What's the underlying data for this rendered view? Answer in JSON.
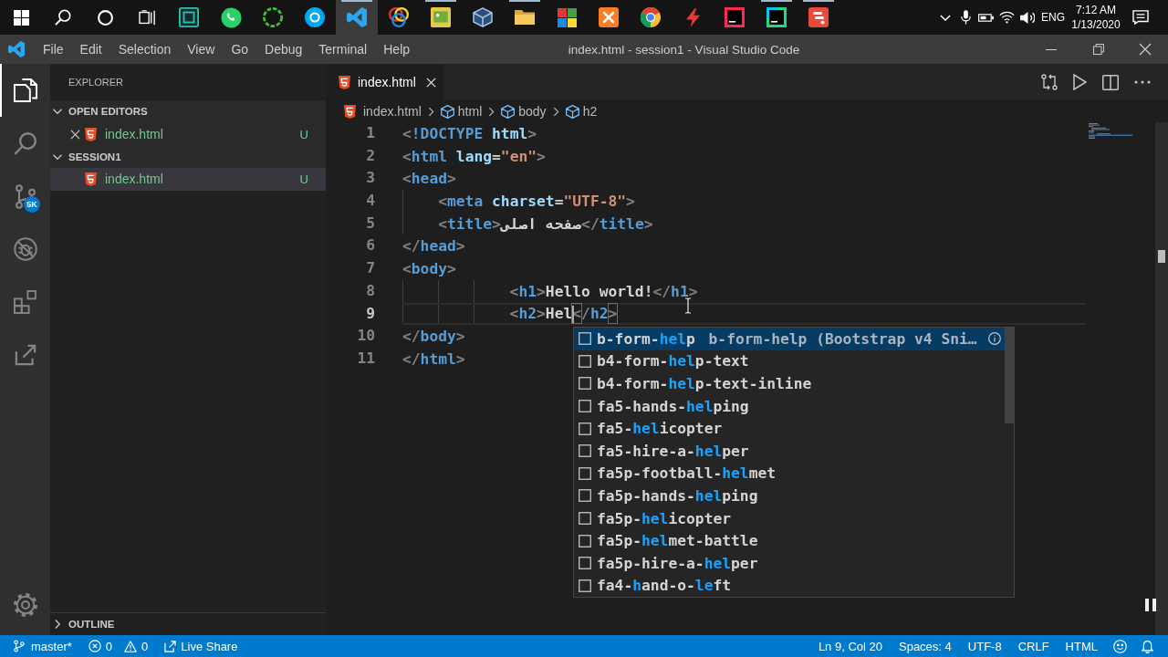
{
  "taskbar": {
    "buttons": [
      {
        "selected": false,
        "running": false
      },
      {
        "selected": false,
        "running": false
      },
      {
        "selected": false,
        "running": false
      },
      {
        "selected": false,
        "running": false
      },
      {
        "selected": false,
        "running": false
      },
      {
        "selected": false,
        "running": false
      },
      {
        "selected": false,
        "running": false
      },
      {
        "selected": false,
        "running": false
      },
      {
        "selected": true,
        "running": true
      },
      {
        "selected": false,
        "running": false
      },
      {
        "selected": false,
        "running": true
      },
      {
        "selected": false,
        "running": false
      },
      {
        "selected": false,
        "running": true
      },
      {
        "selected": false,
        "running": false
      },
      {
        "selected": false,
        "running": false
      },
      {
        "selected": false,
        "running": false
      },
      {
        "selected": false,
        "running": false
      },
      {
        "selected": false,
        "running": false
      },
      {
        "selected": false,
        "running": true
      },
      {
        "selected": false,
        "running": true
      }
    ],
    "tray": {
      "language": "ENG",
      "time": "7:12 AM",
      "date": "1/13/2020"
    }
  },
  "window": {
    "menu": [
      "File",
      "Edit",
      "Selection",
      "View",
      "Go",
      "Debug",
      "Terminal",
      "Help"
    ],
    "title": "index.html - session1 - Visual Studio Code"
  },
  "activity_bar": {
    "items": [
      {
        "selected": true
      },
      {
        "selected": false
      },
      {
        "selected": false,
        "badge": "5K"
      },
      {
        "selected": false
      },
      {
        "selected": false
      },
      {
        "selected": false
      }
    ]
  },
  "sidebar": {
    "title": "EXPLORER",
    "sections": [
      {
        "kind": "open_editors",
        "title": "OPEN EDITORS",
        "expanded": true,
        "items": [
          {
            "name": "index.html",
            "status": "U",
            "selected": false
          }
        ]
      },
      {
        "kind": "folder",
        "title": "SESSION1",
        "expanded": true,
        "items": [
          {
            "name": "index.html",
            "status": "U",
            "selected": true
          }
        ]
      }
    ],
    "outline": {
      "title": "OUTLINE",
      "expanded": false
    }
  },
  "tabs": [
    {
      "label": "index.html",
      "selected": true
    }
  ],
  "breadcrumb": [
    {
      "kind": "file",
      "label": "index.html"
    },
    {
      "kind": "element",
      "label": "html"
    },
    {
      "kind": "element",
      "label": "body"
    },
    {
      "kind": "element",
      "label": "h2"
    }
  ],
  "editor": {
    "lines": [
      {
        "number": "1",
        "current": false,
        "tokens": [
          {
            "kind": "punct",
            "text": "<"
          },
          {
            "kind": "tag",
            "text": "!DOCTYPE"
          },
          {
            "kind": "attr",
            "text": " html"
          },
          {
            "kind": "punct",
            "text": ">"
          }
        ]
      },
      {
        "number": "2",
        "current": false,
        "tokens": [
          {
            "kind": "punct",
            "text": "<"
          },
          {
            "kind": "tag",
            "text": "html"
          },
          {
            "kind": "attr",
            "text": " lang"
          },
          {
            "kind": "text",
            "text": "="
          },
          {
            "kind": "string",
            "text": "\"en\""
          },
          {
            "kind": "punct",
            "text": ">"
          }
        ]
      },
      {
        "number": "3",
        "current": false,
        "tokens": [
          {
            "kind": "punct",
            "text": "<"
          },
          {
            "kind": "tag",
            "text": "head"
          },
          {
            "kind": "punct",
            "text": ">"
          }
        ]
      },
      {
        "number": "4",
        "current": false,
        "tokens": [
          {
            "kind": "punct",
            "text": "    <"
          },
          {
            "kind": "tag",
            "text": "meta"
          },
          {
            "kind": "attr",
            "text": " charset"
          },
          {
            "kind": "text",
            "text": "="
          },
          {
            "kind": "string",
            "text": "\"UTF-8\""
          },
          {
            "kind": "punct",
            "text": ">"
          }
        ]
      },
      {
        "number": "5",
        "current": false,
        "tokens": [
          {
            "kind": "punct",
            "text": "    <"
          },
          {
            "kind": "tag",
            "text": "title"
          },
          {
            "kind": "punct",
            "text": ">"
          },
          {
            "kind": "text",
            "text": "صفحه اصلی"
          },
          {
            "kind": "punct",
            "text": "</"
          },
          {
            "kind": "tag",
            "text": "title"
          },
          {
            "kind": "punct",
            "text": ">"
          }
        ]
      },
      {
        "number": "6",
        "current": false,
        "tokens": [
          {
            "kind": "punct",
            "text": "</"
          },
          {
            "kind": "tag",
            "text": "head"
          },
          {
            "kind": "punct",
            "text": ">"
          }
        ]
      },
      {
        "number": "7",
        "current": false,
        "tokens": [
          {
            "kind": "punct",
            "text": "<"
          },
          {
            "kind": "tag",
            "text": "body"
          },
          {
            "kind": "punct",
            "text": ">"
          }
        ]
      },
      {
        "number": "8",
        "current": false,
        "tokens": [
          {
            "kind": "punct",
            "text": "            <"
          },
          {
            "kind": "tag",
            "text": "h1"
          },
          {
            "kind": "punct",
            "text": ">"
          },
          {
            "kind": "text",
            "text": "Hello world!"
          },
          {
            "kind": "punct",
            "text": "</"
          },
          {
            "kind": "tag",
            "text": "h1"
          },
          {
            "kind": "punct",
            "text": ">"
          }
        ]
      },
      {
        "number": "9",
        "current": true,
        "tokens": [
          {
            "kind": "punct",
            "text": "            <"
          },
          {
            "kind": "tag",
            "text": "h2"
          },
          {
            "kind": "punct",
            "text": ">"
          },
          {
            "kind": "text",
            "text": "Hel"
          },
          {
            "kind": "caret"
          },
          {
            "kind": "match",
            "text": "<"
          },
          {
            "kind": "punct",
            "text": "/"
          },
          {
            "kind": "tag",
            "text": "h2"
          },
          {
            "kind": "match",
            "text": ">"
          }
        ]
      },
      {
        "number": "10",
        "current": false,
        "tokens": [
          {
            "kind": "punct",
            "text": "</"
          },
          {
            "kind": "tag",
            "text": "body"
          },
          {
            "kind": "punct",
            "text": ">"
          }
        ]
      },
      {
        "number": "11",
        "current": false,
        "tokens": [
          {
            "kind": "punct",
            "text": "</"
          },
          {
            "kind": "tag",
            "text": "html"
          },
          {
            "kind": "punct",
            "text": ">"
          }
        ]
      }
    ]
  },
  "suggest": {
    "items": [
      {
        "parts": [
          {
            "text": "b-form-",
            "match": false
          },
          {
            "text": "hel",
            "match": true
          },
          {
            "text": "p",
            "match": false
          }
        ],
        "detail": "b-form-help (Bootstrap v4 Sni…",
        "selected": true
      },
      {
        "parts": [
          {
            "text": "b4-form-",
            "match": false
          },
          {
            "text": "hel",
            "match": true
          },
          {
            "text": "p-text",
            "match": false
          }
        ],
        "selected": false
      },
      {
        "parts": [
          {
            "text": "b4-form-",
            "match": false
          },
          {
            "text": "hel",
            "match": true
          },
          {
            "text": "p-text-inline",
            "match": false
          }
        ],
        "selected": false
      },
      {
        "parts": [
          {
            "text": "fa5-hands-",
            "match": false
          },
          {
            "text": "hel",
            "match": true
          },
          {
            "text": "ping",
            "match": false
          }
        ],
        "selected": false
      },
      {
        "parts": [
          {
            "text": "fa5-",
            "match": false
          },
          {
            "text": "hel",
            "match": true
          },
          {
            "text": "icopter",
            "match": false
          }
        ],
        "selected": false
      },
      {
        "parts": [
          {
            "text": "fa5-hire-a-",
            "match": false
          },
          {
            "text": "hel",
            "match": true
          },
          {
            "text": "per",
            "match": false
          }
        ],
        "selected": false
      },
      {
        "parts": [
          {
            "text": "fa5p-football-",
            "match": false
          },
          {
            "text": "hel",
            "match": true
          },
          {
            "text": "met",
            "match": false
          }
        ],
        "selected": false
      },
      {
        "parts": [
          {
            "text": "fa5p-hands-",
            "match": false
          },
          {
            "text": "hel",
            "match": true
          },
          {
            "text": "ping",
            "match": false
          }
        ],
        "selected": false
      },
      {
        "parts": [
          {
            "text": "fa5p-",
            "match": false
          },
          {
            "text": "hel",
            "match": true
          },
          {
            "text": "icopter",
            "match": false
          }
        ],
        "selected": false
      },
      {
        "parts": [
          {
            "text": "fa5p-",
            "match": false
          },
          {
            "text": "hel",
            "match": true
          },
          {
            "text": "met-battle",
            "match": false
          }
        ],
        "selected": false
      },
      {
        "parts": [
          {
            "text": "fa5p-hire-a-",
            "match": false
          },
          {
            "text": "hel",
            "match": true
          },
          {
            "text": "per",
            "match": false
          }
        ],
        "selected": false
      },
      {
        "parts": [
          {
            "text": "fa4-",
            "match": false
          },
          {
            "text": "h",
            "match": true
          },
          {
            "text": "and-o-",
            "match": false
          },
          {
            "text": "le",
            "match": true
          },
          {
            "text": "ft",
            "match": false
          }
        ],
        "selected": false
      }
    ]
  },
  "status_bar": {
    "branch": "master*",
    "errors": "0",
    "warnings": "0",
    "live_share": "Live Share",
    "items": [
      "Ln 9, Col 20",
      "Spaces: 4",
      "UTF-8",
      "CRLF",
      "HTML"
    ]
  }
}
